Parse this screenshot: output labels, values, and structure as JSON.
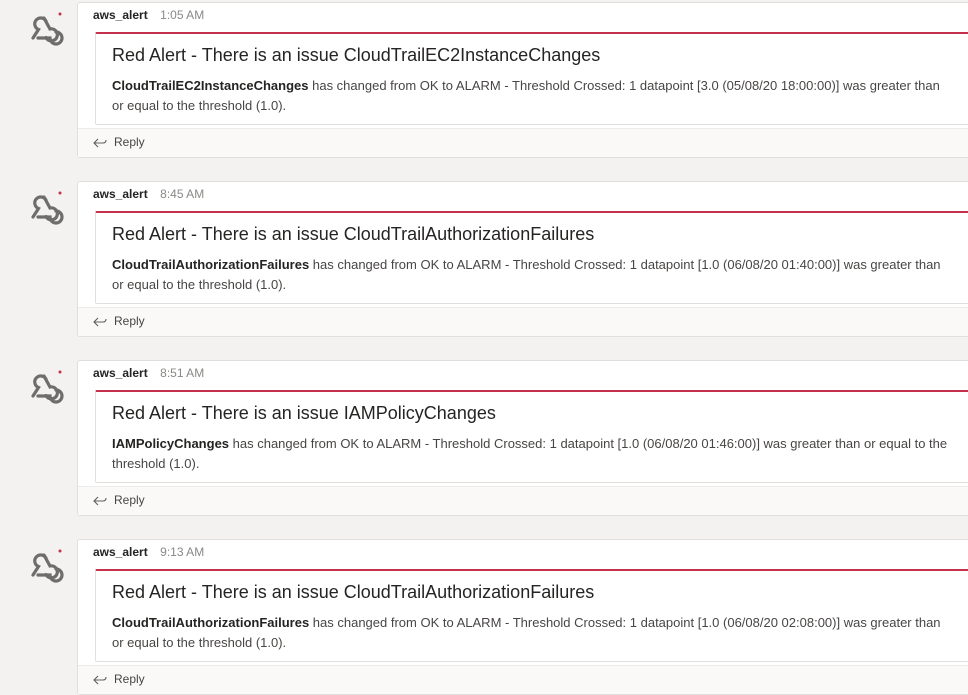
{
  "reply_label": "Reply",
  "accent_color": "#c4314b",
  "messages": [
    {
      "sender": "aws_alert",
      "time": "1:05 AM",
      "title": "Red Alert - There is an issue CloudTrailEC2InstanceChanges",
      "alarm_name": "CloudTrailEC2InstanceChanges",
      "body": " has changed from OK to ALARM - Threshold Crossed: 1 datapoint [3.0 (05/08/20 18:00:00)] was greater than or equal to the threshold (1.0)."
    },
    {
      "sender": "aws_alert",
      "time": "8:45 AM",
      "title": "Red Alert - There is an issue CloudTrailAuthorizationFailures",
      "alarm_name": "CloudTrailAuthorizationFailures",
      "body": " has changed from OK to ALARM - Threshold Crossed: 1 datapoint [1.0 (06/08/20 01:40:00)] was greater than or equal to the threshold (1.0)."
    },
    {
      "sender": "aws_alert",
      "time": "8:51 AM",
      "title": "Red Alert - There is an issue IAMPolicyChanges",
      "alarm_name": "IAMPolicyChanges",
      "body": " has changed from OK to ALARM - Threshold Crossed: 1 datapoint [1.0 (06/08/20 01:46:00)] was greater than or equal to the threshold (1.0)."
    },
    {
      "sender": "aws_alert",
      "time": "9:13 AM",
      "title": "Red Alert - There is an issue CloudTrailAuthorizationFailures",
      "alarm_name": "CloudTrailAuthorizationFailures",
      "body": " has changed from OK to ALARM - Threshold Crossed: 1 datapoint [1.0 (06/08/20 02:08:00)] was greater than or equal to the threshold (1.0)."
    }
  ]
}
